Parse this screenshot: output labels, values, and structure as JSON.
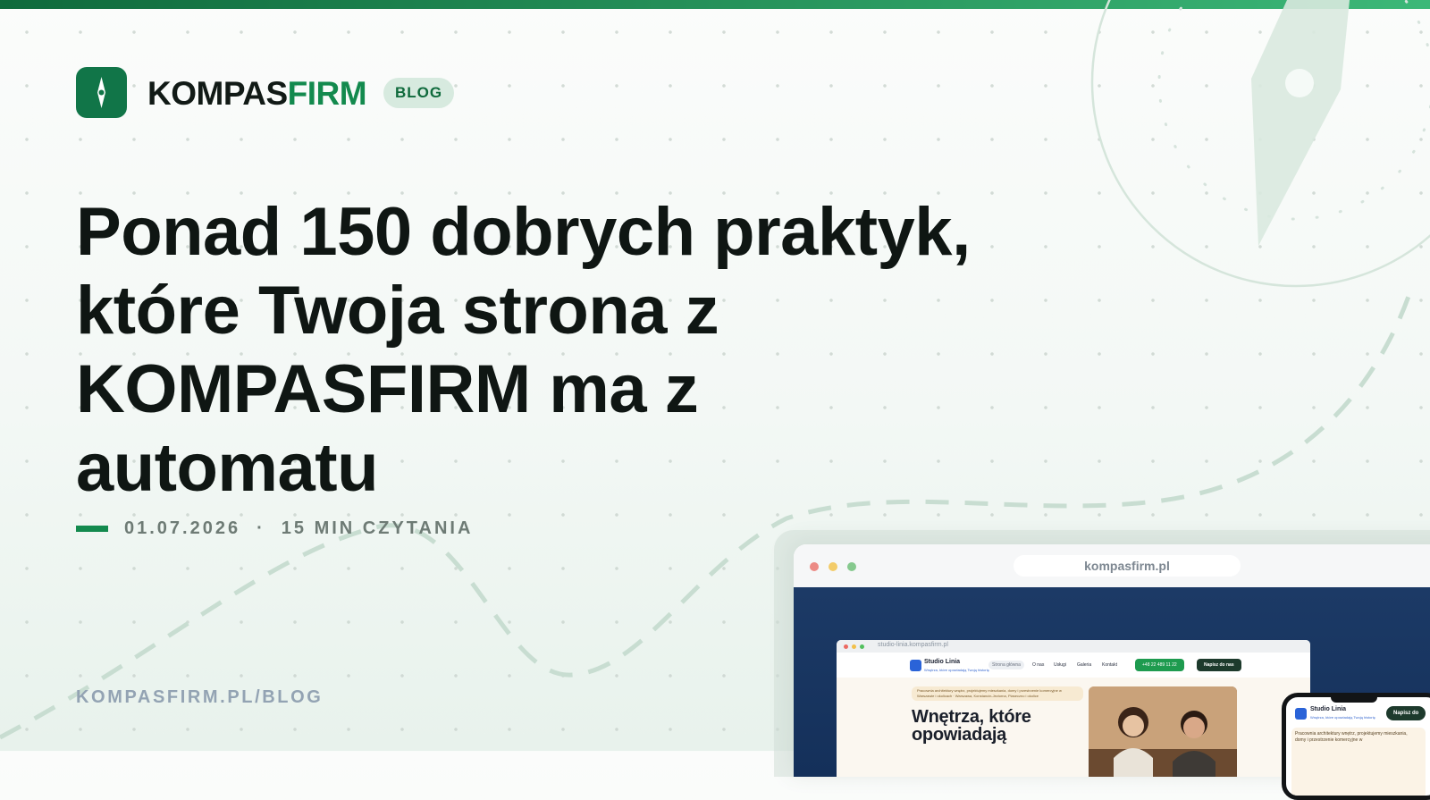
{
  "brand": {
    "name_primary": "KOMPAS",
    "name_accent": "FIRM",
    "badge": "BLOG",
    "logo_icon": "compass-needle-icon"
  },
  "article": {
    "title": "Ponad 150 dobrych praktyk, które Twoja strona z KOMPASFIRM ma z automatu",
    "date": "01.07.2026",
    "separator": "·",
    "reading_time": "15 MIN CZYTANIA"
  },
  "footer": {
    "url": "KOMPASFIRM.PL/BLOG"
  },
  "mockup": {
    "browser_url": "kompasfirm.pl",
    "inner_site": {
      "url": "studio-linia.kompasfirm.pl",
      "name": "Studio Linia",
      "tagline": "Wnętrza, które opowiadają Twoją historię",
      "nav": [
        "Strona główna",
        "O nas",
        "Usługi",
        "Galeria",
        "Kontakt"
      ],
      "phone": "+48 22 489 11 22",
      "cta": "Napisz do nas",
      "hero_pill": "Pracownia architektury wnętrz, projektujemy mieszkania, domy i przestrzenie komercyjne w Warszawie i okolicach · Warszawa, Konstancin-Jeziorna, Piaseczno i okolice",
      "hero_heading": "Wnętrza, które opowiadają"
    },
    "phone_site": {
      "name": "Studio Linia",
      "tagline": "Wnętrza, które opowiadają Twoją historię",
      "cta": "Napisz do",
      "card_text": "Pracownia architektury wnętrz, projektujemy mieszkania, domy i przestrzenie komercyjne w"
    }
  },
  "colors": {
    "brand_green": "#117548",
    "accent_green": "#138a4e",
    "headline": "#0f1613",
    "meta_gray": "#6e7b75",
    "footer_gray": "#93a3b3"
  }
}
